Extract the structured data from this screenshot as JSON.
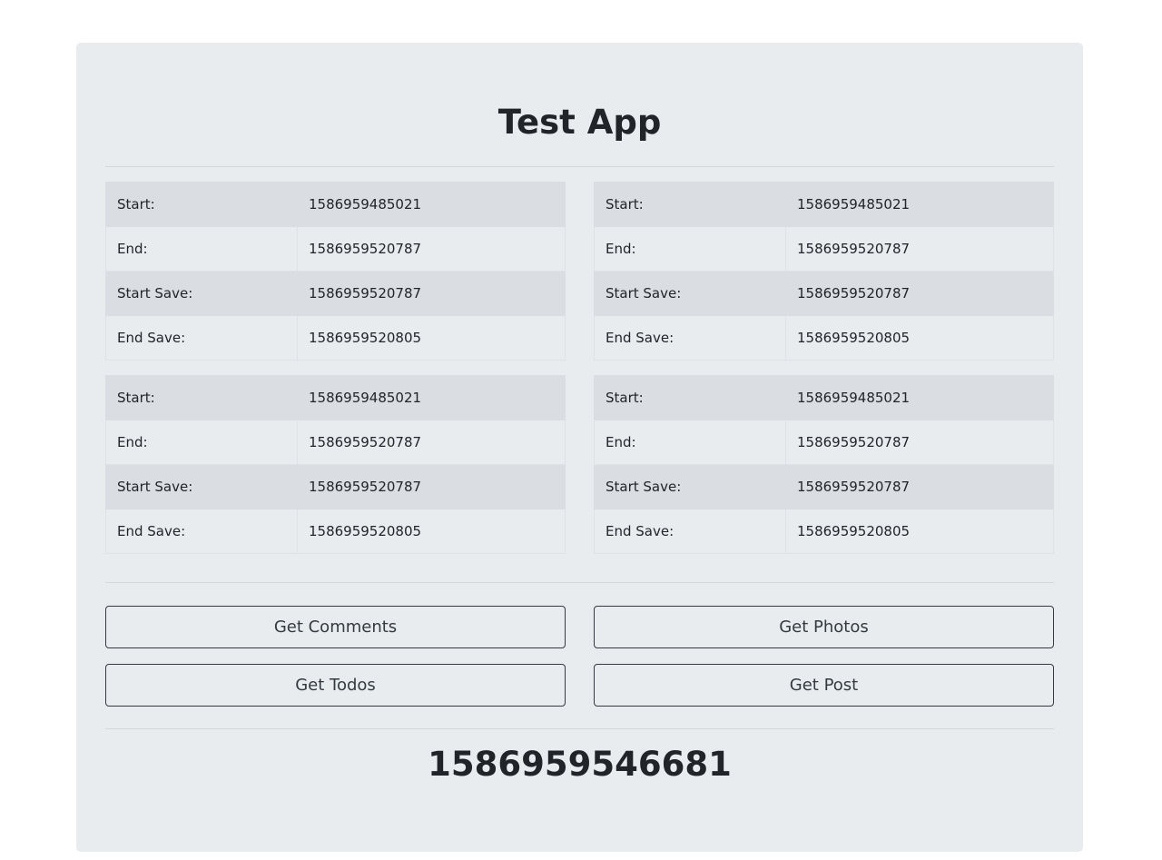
{
  "app": {
    "title": "Test App"
  },
  "tables": [
    {
      "rows": [
        {
          "label": "Start:",
          "value": "1586959485021"
        },
        {
          "label": "End:",
          "value": "1586959520787"
        },
        {
          "label": "Start Save:",
          "value": "1586959520787"
        },
        {
          "label": "End Save:",
          "value": "1586959520805"
        }
      ]
    },
    {
      "rows": [
        {
          "label": "Start:",
          "value": "1586959485021"
        },
        {
          "label": "End:",
          "value": "1586959520787"
        },
        {
          "label": "Start Save:",
          "value": "1586959520787"
        },
        {
          "label": "End Save:",
          "value": "1586959520805"
        }
      ]
    },
    {
      "rows": [
        {
          "label": "Start:",
          "value": "1586959485021"
        },
        {
          "label": "End:",
          "value": "1586959520787"
        },
        {
          "label": "Start Save:",
          "value": "1586959520787"
        },
        {
          "label": "End Save:",
          "value": "1586959520805"
        }
      ]
    },
    {
      "rows": [
        {
          "label": "Start:",
          "value": "1586959485021"
        },
        {
          "label": "End:",
          "value": "1586959520787"
        },
        {
          "label": "Start Save:",
          "value": "1586959520787"
        },
        {
          "label": "End Save:",
          "value": "1586959520805"
        }
      ]
    }
  ],
  "buttons": {
    "get_comments": "Get Comments",
    "get_photos": "Get Photos",
    "get_todos": "Get Todos",
    "get_post": "Get Post"
  },
  "current_timestamp": "1586959546681",
  "colors": {
    "panel_bg": "#e9ecef",
    "stripe_bg": "#dadde1",
    "button_border": "#343a40",
    "text": "#212529"
  }
}
